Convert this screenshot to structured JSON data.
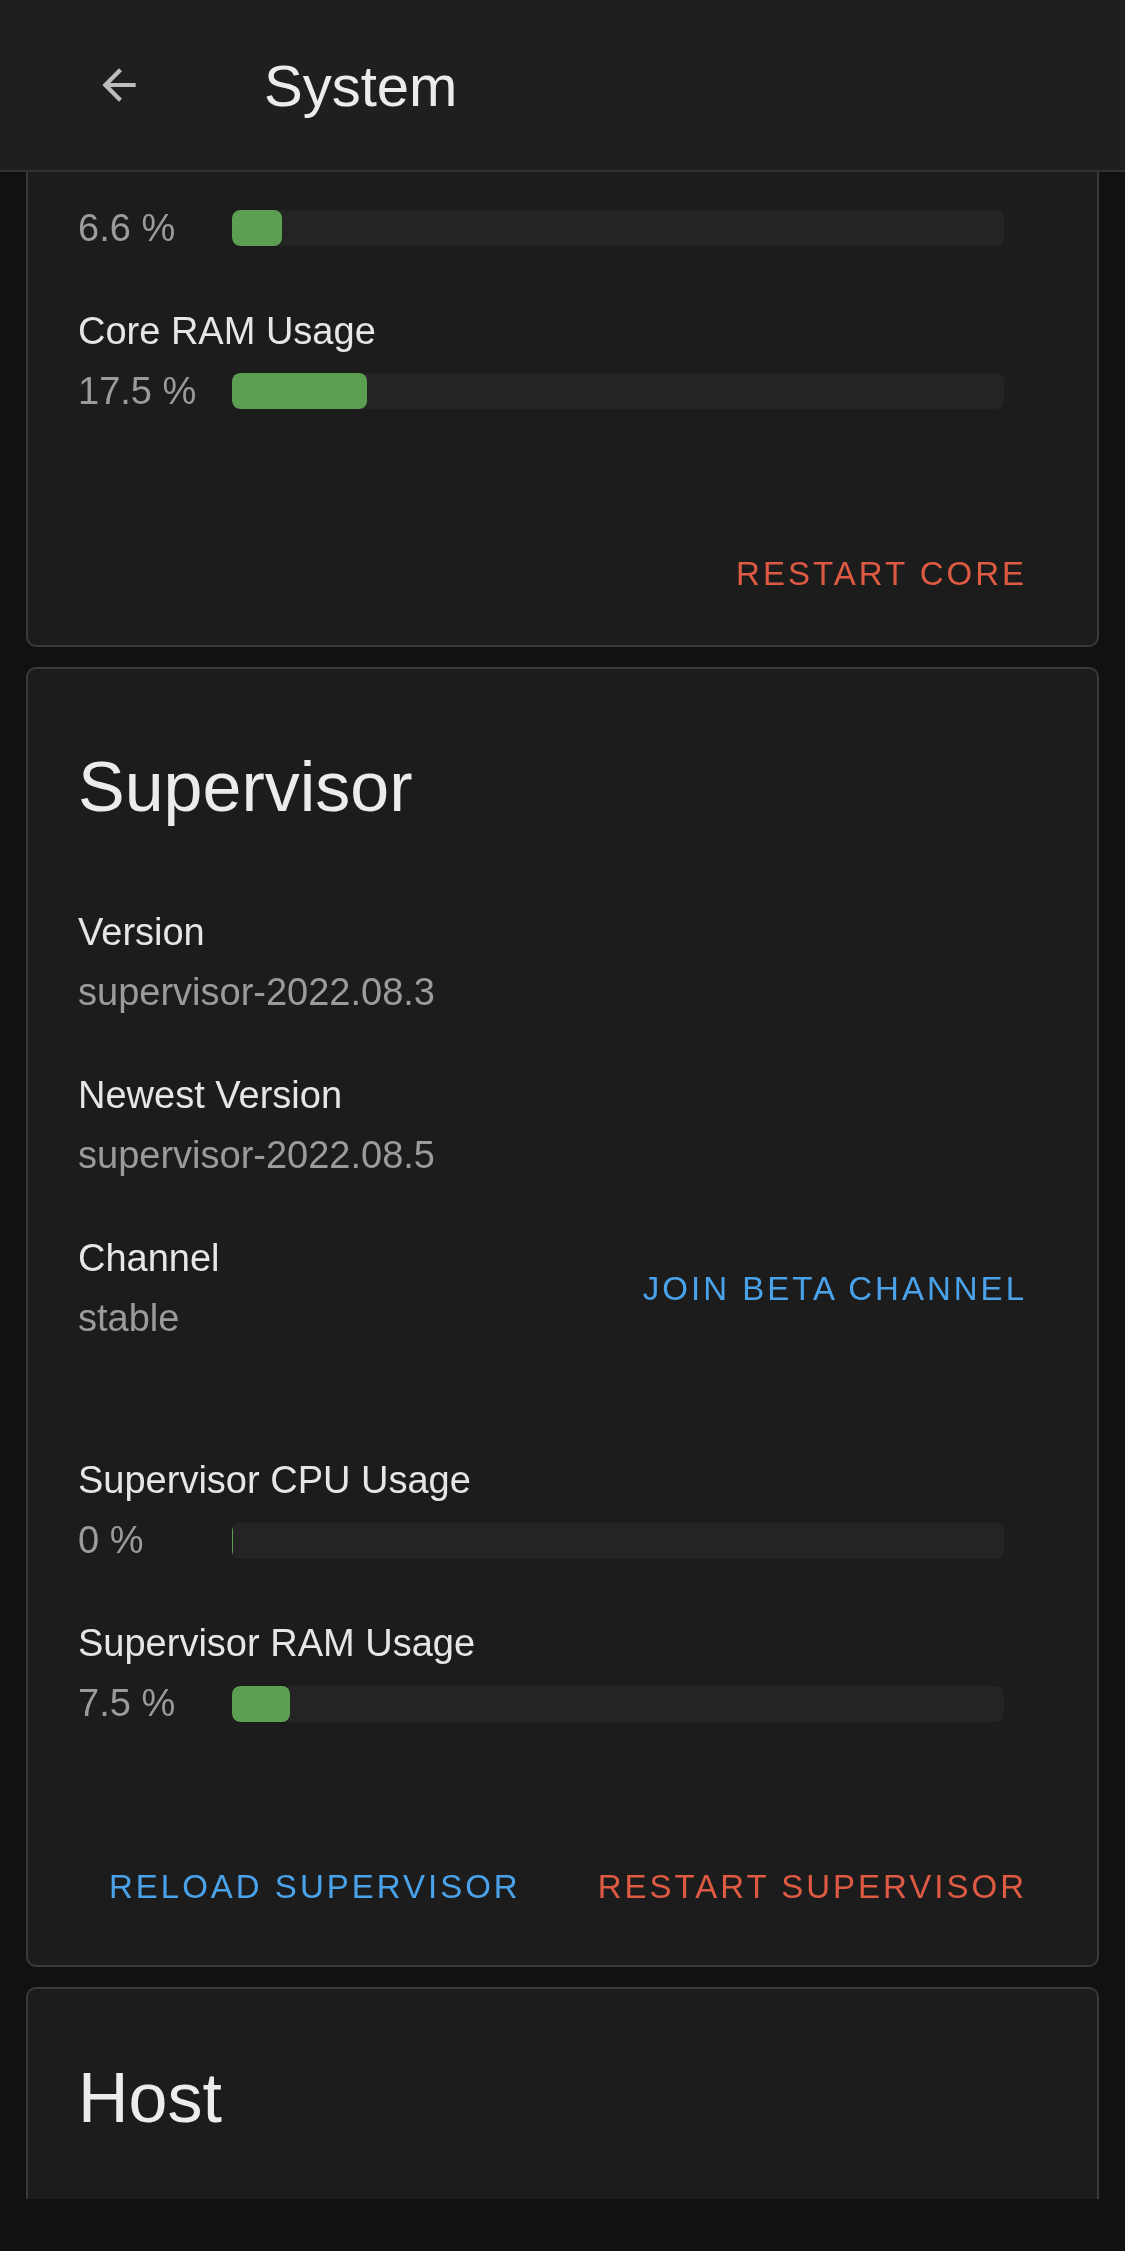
{
  "header": {
    "title": "System"
  },
  "core_card": {
    "metrics": [
      {
        "value": "6.6 %",
        "level": 0.065
      },
      {
        "label": "Core RAM Usage",
        "value": "17.5 %",
        "level": 0.175
      }
    ],
    "actions": [
      {
        "label": "RESTART CORE",
        "kind": "danger"
      }
    ]
  },
  "supervisor_card": {
    "title": "Supervisor",
    "fields": [
      {
        "label": "Version",
        "value": "supervisor-2022.08.3"
      },
      {
        "label": "Newest Version",
        "value": "supervisor-2022.08.5"
      },
      {
        "label": "Channel",
        "value": "stable",
        "action": "JOIN BETA CHANNEL"
      }
    ],
    "metrics": [
      {
        "label": "Supervisor CPU Usage",
        "value": "0 %",
        "level": 0
      },
      {
        "label": "Supervisor RAM Usage",
        "value": "7.5 %",
        "level": 0.075
      }
    ],
    "actions": [
      {
        "label": "RELOAD SUPERVISOR",
        "kind": "primary"
      },
      {
        "label": "RESTART SUPERVISOR",
        "kind": "danger"
      }
    ]
  },
  "host_card": {
    "title": "Host"
  }
}
